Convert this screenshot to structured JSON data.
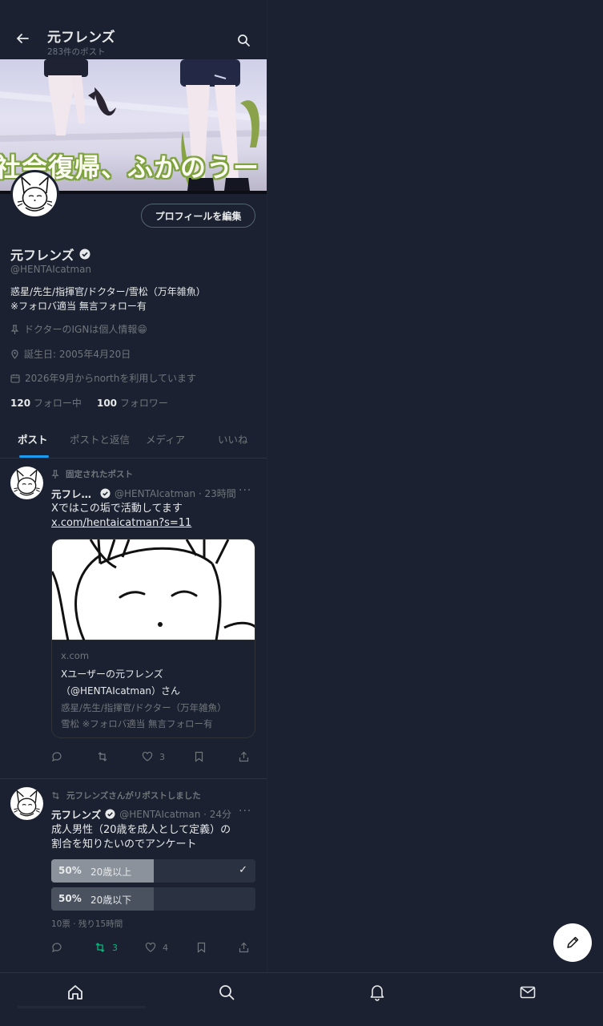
{
  "header": {
    "title": "元フレンズ",
    "post_count": "283件のポスト"
  },
  "banner": {
    "caption": "社会復帰、ふかのうー"
  },
  "profile": {
    "edit_button": "プロフィールを編集",
    "name": "元フレンズ",
    "handle": "@HENTAIcatman",
    "bio_line1": "惑星/先生/指揮官/ドクター/雪松（万年雑魚）",
    "bio_line2": "※フォロバ適当 無言フォロー有",
    "pinned_note": "ドクターのIGNは個人情報😁",
    "birthday": "誕生日: 2005年4月20日",
    "joined": "2026年9月からnorthを利用しています",
    "following_count": "120",
    "following_label": "フォロー中",
    "followers_count": "100",
    "followers_label": "フォロワー"
  },
  "tabs": [
    "ポスト",
    "ポストと返信",
    "メディア",
    "いいね"
  ],
  "posts": [
    {
      "context": "固定されたポスト",
      "name": "元フレ…",
      "handle_time": "@HENTAIcatman · 23時間",
      "text": "Xではこの垢で活動してます",
      "link": "x.com/hentaicatman?s=11",
      "card": {
        "domain": "x.com",
        "title_line1": "Xユーザーの元フレンズ",
        "title_line2": "（@HENTAIcatman）さん",
        "desc_line1": "惑星/先生/指揮官/ドクター（万年雑魚）",
        "desc_line2": "雪松 ※フォロバ適当 無言フォロー有"
      },
      "likes": "3"
    },
    {
      "context": "元フレンズさんがリポストしました",
      "name": "元フレンズ",
      "handle_time": "@HENTAIcatman · 24分",
      "text_line1": "成人男性（20歳を成人として定義）の",
      "text_line2": "割合を知りたいのでアンケート",
      "poll": [
        {
          "percent": "50%",
          "label": "20歳以上",
          "fraction": 0.5,
          "selected": true
        },
        {
          "percent": "50%",
          "label": "20歳以下",
          "fraction": 0.5,
          "selected": false
        }
      ],
      "poll_meta": "10票 · 残り15時間",
      "check": "✓",
      "reposts": "3",
      "likes": "4"
    }
  ],
  "colors": {
    "background": "#1b2130",
    "accent": "#1d9bf0",
    "repost_green": "#00ba7c",
    "poll_selected": "#8b929c",
    "poll_other": "#4a525f"
  },
  "icons": [
    "back-arrow-icon",
    "search-icon",
    "verified-icon",
    "pin-icon",
    "location-icon",
    "calendar-icon",
    "reply-icon",
    "repost-icon",
    "like-icon",
    "bookmark-icon",
    "share-icon",
    "compose-icon",
    "home-icon",
    "bell-icon",
    "mail-icon"
  ]
}
